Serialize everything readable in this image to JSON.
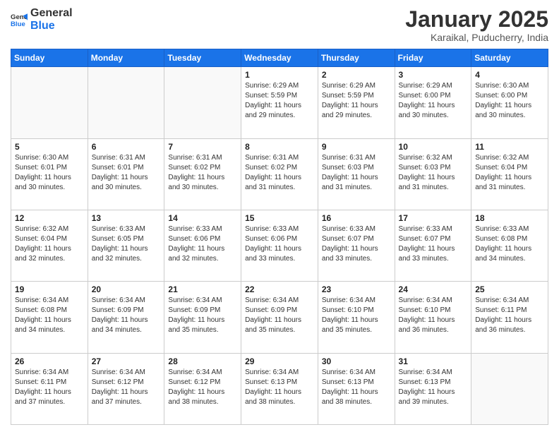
{
  "header": {
    "logo_line1": "General",
    "logo_line2": "Blue",
    "month": "January 2025",
    "location": "Karaikal, Puducherry, India"
  },
  "weekdays": [
    "Sunday",
    "Monday",
    "Tuesday",
    "Wednesday",
    "Thursday",
    "Friday",
    "Saturday"
  ],
  "weeks": [
    [
      {
        "day": "",
        "sunrise": "",
        "sunset": "",
        "daylight": ""
      },
      {
        "day": "",
        "sunrise": "",
        "sunset": "",
        "daylight": ""
      },
      {
        "day": "",
        "sunrise": "",
        "sunset": "",
        "daylight": ""
      },
      {
        "day": "1",
        "sunrise": "6:29 AM",
        "sunset": "5:59 PM",
        "daylight": "11 hours and 29 minutes."
      },
      {
        "day": "2",
        "sunrise": "6:29 AM",
        "sunset": "5:59 PM",
        "daylight": "11 hours and 29 minutes."
      },
      {
        "day": "3",
        "sunrise": "6:29 AM",
        "sunset": "6:00 PM",
        "daylight": "11 hours and 30 minutes."
      },
      {
        "day": "4",
        "sunrise": "6:30 AM",
        "sunset": "6:00 PM",
        "daylight": "11 hours and 30 minutes."
      }
    ],
    [
      {
        "day": "5",
        "sunrise": "6:30 AM",
        "sunset": "6:01 PM",
        "daylight": "11 hours and 30 minutes."
      },
      {
        "day": "6",
        "sunrise": "6:31 AM",
        "sunset": "6:01 PM",
        "daylight": "11 hours and 30 minutes."
      },
      {
        "day": "7",
        "sunrise": "6:31 AM",
        "sunset": "6:02 PM",
        "daylight": "11 hours and 30 minutes."
      },
      {
        "day": "8",
        "sunrise": "6:31 AM",
        "sunset": "6:02 PM",
        "daylight": "11 hours and 31 minutes."
      },
      {
        "day": "9",
        "sunrise": "6:31 AM",
        "sunset": "6:03 PM",
        "daylight": "11 hours and 31 minutes."
      },
      {
        "day": "10",
        "sunrise": "6:32 AM",
        "sunset": "6:03 PM",
        "daylight": "11 hours and 31 minutes."
      },
      {
        "day": "11",
        "sunrise": "6:32 AM",
        "sunset": "6:04 PM",
        "daylight": "11 hours and 31 minutes."
      }
    ],
    [
      {
        "day": "12",
        "sunrise": "6:32 AM",
        "sunset": "6:04 PM",
        "daylight": "11 hours and 32 minutes."
      },
      {
        "day": "13",
        "sunrise": "6:33 AM",
        "sunset": "6:05 PM",
        "daylight": "11 hours and 32 minutes."
      },
      {
        "day": "14",
        "sunrise": "6:33 AM",
        "sunset": "6:06 PM",
        "daylight": "11 hours and 32 minutes."
      },
      {
        "day": "15",
        "sunrise": "6:33 AM",
        "sunset": "6:06 PM",
        "daylight": "11 hours and 33 minutes."
      },
      {
        "day": "16",
        "sunrise": "6:33 AM",
        "sunset": "6:07 PM",
        "daylight": "11 hours and 33 minutes."
      },
      {
        "day": "17",
        "sunrise": "6:33 AM",
        "sunset": "6:07 PM",
        "daylight": "11 hours and 33 minutes."
      },
      {
        "day": "18",
        "sunrise": "6:33 AM",
        "sunset": "6:08 PM",
        "daylight": "11 hours and 34 minutes."
      }
    ],
    [
      {
        "day": "19",
        "sunrise": "6:34 AM",
        "sunset": "6:08 PM",
        "daylight": "11 hours and 34 minutes."
      },
      {
        "day": "20",
        "sunrise": "6:34 AM",
        "sunset": "6:09 PM",
        "daylight": "11 hours and 34 minutes."
      },
      {
        "day": "21",
        "sunrise": "6:34 AM",
        "sunset": "6:09 PM",
        "daylight": "11 hours and 35 minutes."
      },
      {
        "day": "22",
        "sunrise": "6:34 AM",
        "sunset": "6:09 PM",
        "daylight": "11 hours and 35 minutes."
      },
      {
        "day": "23",
        "sunrise": "6:34 AM",
        "sunset": "6:10 PM",
        "daylight": "11 hours and 35 minutes."
      },
      {
        "day": "24",
        "sunrise": "6:34 AM",
        "sunset": "6:10 PM",
        "daylight": "11 hours and 36 minutes."
      },
      {
        "day": "25",
        "sunrise": "6:34 AM",
        "sunset": "6:11 PM",
        "daylight": "11 hours and 36 minutes."
      }
    ],
    [
      {
        "day": "26",
        "sunrise": "6:34 AM",
        "sunset": "6:11 PM",
        "daylight": "11 hours and 37 minutes."
      },
      {
        "day": "27",
        "sunrise": "6:34 AM",
        "sunset": "6:12 PM",
        "daylight": "11 hours and 37 minutes."
      },
      {
        "day": "28",
        "sunrise": "6:34 AM",
        "sunset": "6:12 PM",
        "daylight": "11 hours and 38 minutes."
      },
      {
        "day": "29",
        "sunrise": "6:34 AM",
        "sunset": "6:13 PM",
        "daylight": "11 hours and 38 minutes."
      },
      {
        "day": "30",
        "sunrise": "6:34 AM",
        "sunset": "6:13 PM",
        "daylight": "11 hours and 38 minutes."
      },
      {
        "day": "31",
        "sunrise": "6:34 AM",
        "sunset": "6:13 PM",
        "daylight": "11 hours and 39 minutes."
      },
      {
        "day": "",
        "sunrise": "",
        "sunset": "",
        "daylight": ""
      }
    ]
  ]
}
